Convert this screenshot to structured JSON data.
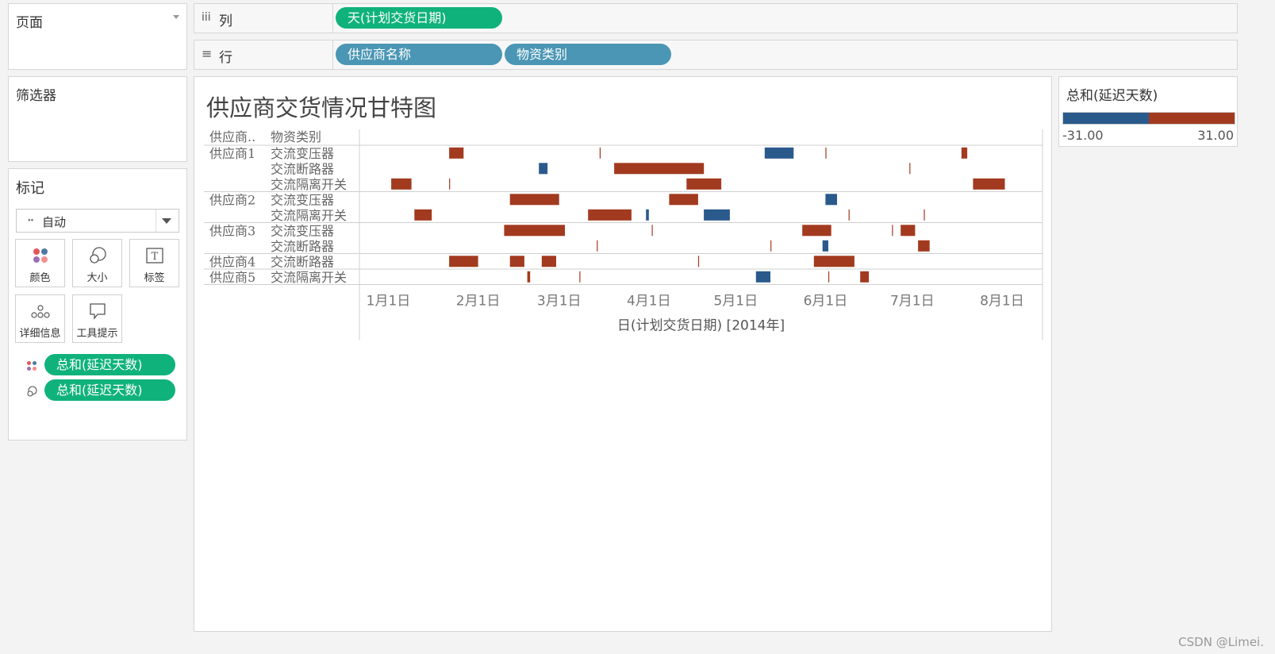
{
  "pages_card": {
    "title": "页面"
  },
  "filters_card": {
    "title": "筛选器"
  },
  "marks_card": {
    "title": "标记",
    "mark_type": "自动",
    "buttons": [
      {
        "label": "颜色",
        "icon": "color-dots-icon"
      },
      {
        "label": "大小",
        "icon": "size-circles-icon"
      },
      {
        "label": "标签",
        "icon": "text-label-icon"
      },
      {
        "label": "详细信息",
        "icon": "detail-dots-icon"
      },
      {
        "label": "工具提示",
        "icon": "tooltip-bubble-icon"
      }
    ],
    "fields": [
      {
        "label": "总和(延迟天数)",
        "icon": "color-dots-icon"
      },
      {
        "label": "总和(延迟天数)",
        "icon": "size-circles-icon"
      }
    ]
  },
  "shelves": {
    "columns": {
      "icon": "iii",
      "label": "列",
      "pills": [
        "天(计划交货日期)"
      ]
    },
    "rows": {
      "icon": "≡",
      "label": "行",
      "pills": [
        "供应商名称",
        "物资类别"
      ]
    }
  },
  "view": {
    "title": "供应商交货情况甘特图"
  },
  "legend": {
    "title": "总和(延迟天数)",
    "min": "-31.00",
    "max": "31.00"
  },
  "colors": {
    "negative": "#2a5a8c",
    "positive": "#a23a1f",
    "green_pill": "#10b27c",
    "blue_pill": "#4a96b4"
  },
  "watermark": "CSDN @Limei.",
  "chart_data": {
    "type": "gantt",
    "xlabel": "日(计划交货日期) [2014年]",
    "xlim": [
      "2013-12-22",
      "2014-08-15"
    ],
    "x_ticks": [
      {
        "date": "2014-01-01",
        "label": "1月1日"
      },
      {
        "date": "2014-02-01",
        "label": "2月1日"
      },
      {
        "date": "2014-03-01",
        "label": "3月1日"
      },
      {
        "date": "2014-04-01",
        "label": "4月1日"
      },
      {
        "date": "2014-05-01",
        "label": "5月1日"
      },
      {
        "date": "2014-06-01",
        "label": "6月1日"
      },
      {
        "date": "2014-07-01",
        "label": "7月1日"
      },
      {
        "date": "2014-08-01",
        "label": "8月1日"
      }
    ],
    "row_headers": [
      "供应商..",
      "物资类别"
    ],
    "groups": [
      {
        "supplier": "供应商1",
        "rows": [
          {
            "category": "交流变压器",
            "tasks": [
              {
                "start": "2014-01-22",
                "delay": 5
              },
              {
                "start": "2014-03-15",
                "delay": 0
              },
              {
                "start": "2014-05-11",
                "delay": -10
              },
              {
                "start": "2014-06-01",
                "delay": 0
              },
              {
                "start": "2014-07-18",
                "delay": 2
              }
            ]
          },
          {
            "category": "交流断路器",
            "tasks": [
              {
                "start": "2014-02-22",
                "delay": -3
              },
              {
                "start": "2014-03-20",
                "delay": 31
              },
              {
                "start": "2014-06-30",
                "delay": 0
              }
            ]
          },
          {
            "category": "交流隔离开关",
            "tasks": [
              {
                "start": "2014-01-02",
                "delay": 7
              },
              {
                "start": "2014-01-22",
                "delay": 0
              },
              {
                "start": "2014-04-14",
                "delay": 12
              },
              {
                "start": "2014-07-22",
                "delay": 11
              }
            ]
          }
        ]
      },
      {
        "supplier": "供应商2",
        "rows": [
          {
            "category": "交流变压器",
            "tasks": [
              {
                "start": "2014-02-12",
                "delay": 17
              },
              {
                "start": "2014-04-08",
                "delay": 10
              },
              {
                "start": "2014-06-01",
                "delay": -4
              }
            ]
          },
          {
            "category": "交流隔离开关",
            "tasks": [
              {
                "start": "2014-01-10",
                "delay": 6
              },
              {
                "start": "2014-03-11",
                "delay": 15
              },
              {
                "start": "2014-03-31",
                "delay": -1
              },
              {
                "start": "2014-04-20",
                "delay": -9
              },
              {
                "start": "2014-06-09",
                "delay": 0
              },
              {
                "start": "2014-07-05",
                "delay": 0
              }
            ]
          }
        ]
      },
      {
        "supplier": "供应商3",
        "rows": [
          {
            "category": "交流变压器",
            "tasks": [
              {
                "start": "2014-02-10",
                "delay": 21
              },
              {
                "start": "2014-04-02",
                "delay": 0
              },
              {
                "start": "2014-05-24",
                "delay": 10
              },
              {
                "start": "2014-06-24",
                "delay": 0
              },
              {
                "start": "2014-06-27",
                "delay": 5
              }
            ]
          },
          {
            "category": "交流断路器",
            "tasks": [
              {
                "start": "2014-03-14",
                "delay": 0
              },
              {
                "start": "2014-05-13",
                "delay": 0
              },
              {
                "start": "2014-05-31",
                "delay": -2
              },
              {
                "start": "2014-07-03",
                "delay": 4
              }
            ]
          }
        ]
      },
      {
        "supplier": "供应商4",
        "rows": [
          {
            "category": "交流断路器",
            "tasks": [
              {
                "start": "2014-01-22",
                "delay": 10
              },
              {
                "start": "2014-02-12",
                "delay": 5
              },
              {
                "start": "2014-02-23",
                "delay": 5
              },
              {
                "start": "2014-04-18",
                "delay": 0
              },
              {
                "start": "2014-05-28",
                "delay": 14
              }
            ]
          }
        ]
      },
      {
        "supplier": "供应商5",
        "rows": [
          {
            "category": "交流隔离开关",
            "tasks": [
              {
                "start": "2014-02-18",
                "delay": 1
              },
              {
                "start": "2014-03-08",
                "delay": 0
              },
              {
                "start": "2014-05-08",
                "delay": -5
              },
              {
                "start": "2014-06-02",
                "delay": 0
              },
              {
                "start": "2014-06-13",
                "delay": 3
              }
            ]
          }
        ]
      }
    ]
  }
}
